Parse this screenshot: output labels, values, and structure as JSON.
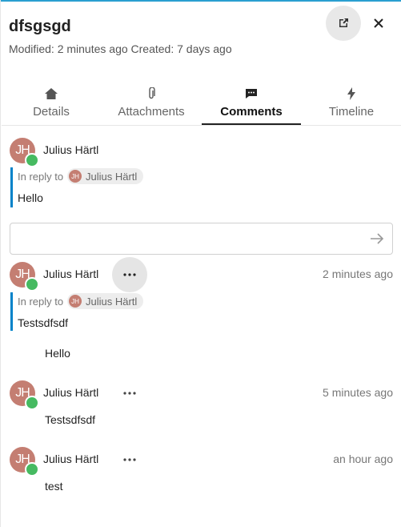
{
  "header": {
    "title": "dfsgsgd",
    "modified": "Modified: 2 minutes ago",
    "created": "Created: 7 days ago"
  },
  "tabs": [
    {
      "label": "Details",
      "icon": "home-icon"
    },
    {
      "label": "Attachments",
      "icon": "paperclip-icon"
    },
    {
      "label": "Comments",
      "icon": "comment-icon",
      "active": true
    },
    {
      "label": "Timeline",
      "icon": "lightning-icon"
    }
  ],
  "reply_preview": {
    "author": "Julius Härtl",
    "initials": "JH",
    "in_reply_to": "In reply to",
    "reply_author": "Julius Härtl",
    "quoted": "Hello"
  },
  "new_comment": {
    "value": "",
    "placeholder": ""
  },
  "comments": [
    {
      "author": "Julius Härtl",
      "initials": "JH",
      "time": "2 minutes ago",
      "in_reply_to": "In reply to",
      "reply_author": "Julius Härtl",
      "quoted": "Testsdfsdf",
      "text": "Hello"
    },
    {
      "author": "Julius Härtl",
      "initials": "JH",
      "time": "5 minutes ago",
      "text": "Testsdfsdf"
    },
    {
      "author": "Julius Härtl",
      "initials": "JH",
      "time": "an hour ago",
      "text": "test"
    }
  ],
  "colors": {
    "accent": "#0082c9",
    "status_online": "#46ba61",
    "avatar": "#c47e72"
  }
}
